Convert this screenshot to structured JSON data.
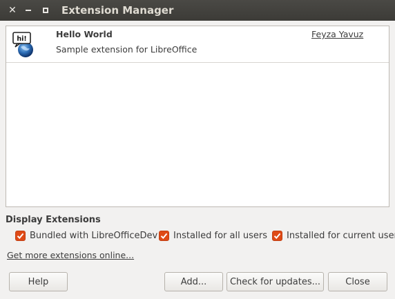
{
  "window": {
    "title": "Extension Manager"
  },
  "extensions": [
    {
      "name": "Hello World",
      "description": "Sample extension for LibreOffice",
      "author": "Feyza Yavuz",
      "icon": "hi-globe-icon",
      "icon_text": "hi!"
    }
  ],
  "display": {
    "label": "Display Extensions",
    "options": [
      {
        "label": "Bundled with LibreOfficeDev",
        "checked": true
      },
      {
        "label": "Installed for all users",
        "checked": true
      },
      {
        "label": "Installed for current user",
        "checked": true
      }
    ]
  },
  "link_text": "Get more extensions online...",
  "buttons": {
    "help": "Help",
    "add": "Add...",
    "check_updates": "Check for updates...",
    "close": "Close"
  },
  "colors": {
    "titlebar": "#3c3b37",
    "checkbox": "#df4a16",
    "background": "#f2f1f0"
  }
}
